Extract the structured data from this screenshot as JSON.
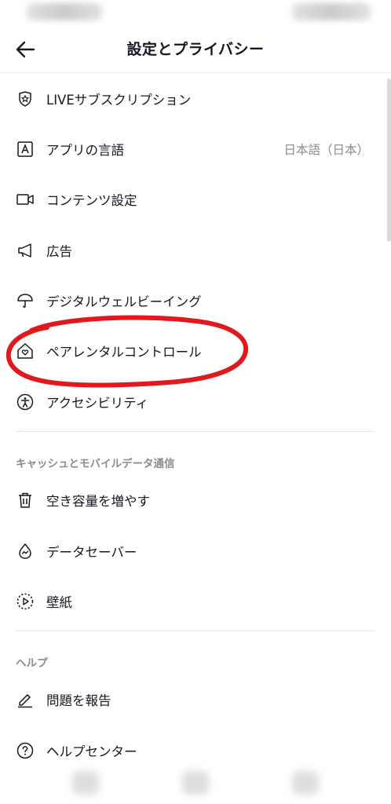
{
  "header": {
    "title": "設定とプライバシー"
  },
  "items": [
    {
      "label": "LIVEサブスクリプション",
      "value": ""
    },
    {
      "label": "アプリの言語",
      "value": "日本語（日本）"
    },
    {
      "label": "コンテンツ設定",
      "value": ""
    },
    {
      "label": "広告",
      "value": ""
    },
    {
      "label": "デジタルウェルビーイング",
      "value": ""
    },
    {
      "label": "ペアレンタルコントロール",
      "value": ""
    },
    {
      "label": "アクセシビリティ",
      "value": ""
    }
  ],
  "cache_section": {
    "title": "キャッシュとモバイルデータ通信",
    "items": [
      {
        "label": "空き容量を増やす"
      },
      {
        "label": "データセーバー"
      },
      {
        "label": "壁紙"
      }
    ]
  },
  "help_section": {
    "title": "ヘルプ",
    "items": [
      {
        "label": "問題を報告"
      },
      {
        "label": "ヘルプセンター"
      }
    ]
  },
  "annotation": {
    "color": "#e0191d",
    "target": "ペアレンタルコントロール"
  }
}
